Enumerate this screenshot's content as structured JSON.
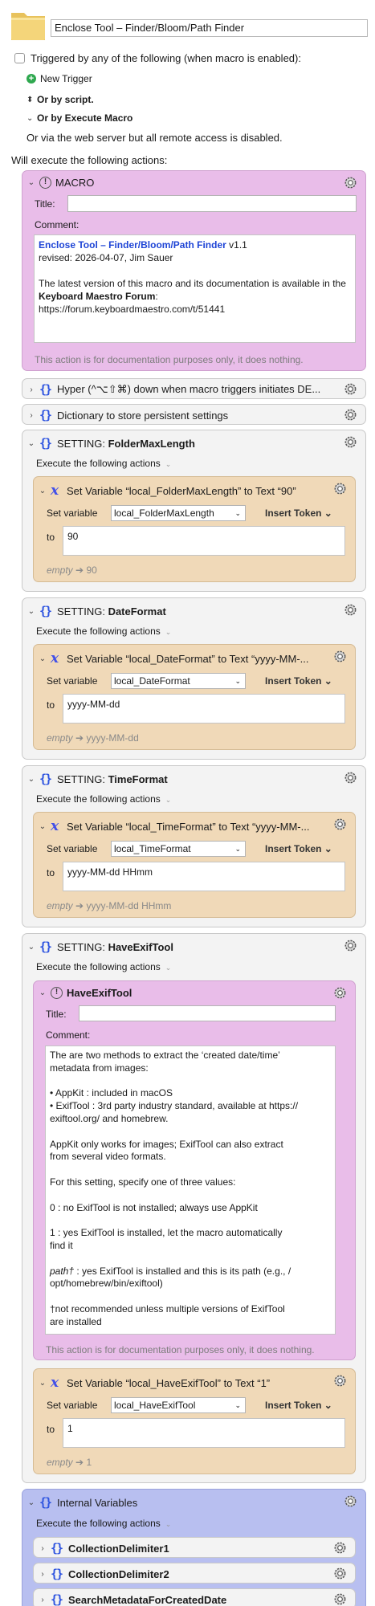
{
  "macro": {
    "name": "Enclose Tool – Finder/Bloom/Path Finder",
    "triggered_by": "Triggered by any of the following (when macro is enabled):",
    "new_trigger": "New Trigger",
    "or_by_script": "Or by script.",
    "or_by_execute": "Or by Execute Macro",
    "web_server_note": "Or via the web server but all remote access is disabled.",
    "will_execute": "Will execute the following actions:"
  },
  "common": {
    "title_label": "Title:",
    "comment_label": "Comment:",
    "doc_caption": "This action is for documentation purposes only, it does nothing.",
    "execute_following": "Execute the following actions",
    "set_variable": "Set variable",
    "to": "to",
    "insert_token": "Insert Token",
    "empty": "empty",
    "arrow": "➔"
  },
  "macro_comment": {
    "title": "MACRO",
    "link": "Enclose Tool – Finder/Bloom/Path Finder",
    "version": " v1.1",
    "revised": "revised: 2026-04-07, Jim Sauer",
    "para1": "The latest version of this macro and its documentation is available in the ",
    "para1_bold": "Keyboard Maestro Forum",
    "para1_end": ":",
    "url": "https://forum.keyboardmaestro.com/t/51441"
  },
  "collapsed": [
    {
      "title": "Hyper (^⌥⇧⌘) down when macro triggers initiates DE..."
    },
    {
      "title": "Dictionary to store persistent settings"
    }
  ],
  "settings": [
    {
      "prefix": "SETTING: ",
      "name": "FolderMaxLength",
      "sv_title": "Set Variable “local_FolderMaxLength” to Text “90”",
      "var": "local_FolderMaxLength",
      "value": "90",
      "result": "90"
    },
    {
      "prefix": "SETTING: ",
      "name": "DateFormat",
      "sv_title": "Set Variable “local_DateFormat” to Text “yyyy-MM-...",
      "var": "local_DateFormat",
      "value": "yyyy-MM-dd",
      "result": "yyyy-MM-dd"
    },
    {
      "prefix": "SETTING: ",
      "name": "TimeFormat",
      "sv_title": "Set Variable “local_TimeFormat” to Text “yyyy-MM-...",
      "var": "local_TimeFormat",
      "value": "yyyy-MM-dd HHmm",
      "result": "yyyy-MM-dd HHmm"
    }
  ],
  "exif": {
    "prefix": "SETTING: ",
    "name": "HaveExifTool",
    "comment_title": "HaveExifTool",
    "lines": [
      "The are two methods to extract the ‘created date/time’",
      "metadata from images:",
      "",
      "• AppKit : included in macOS",
      "• ExifTool : 3rd party industry standard, available at https://",
      "exiftool.org/ and homebrew.",
      "",
      "AppKit only works for images; ExifTool can also extract",
      "from several video formats.",
      "",
      "For this setting, specify one of three values:",
      "",
      "0 : no ExifTool is not installed; always use AppKit",
      "",
      "1 : yes ExifTool is installed, let the macro automatically",
      "find it",
      "",
      "path† : yes ExifTool is installed and this is its path (e.g., /",
      "opt/homebrew/bin/exiftool)",
      "",
      "†not recommended unless multiple versions of ExifTool",
      "are installed"
    ],
    "sv_title": "Set Variable “local_HaveExifTool” to Text “1”",
    "var": "local_HaveExifTool",
    "value": "1",
    "result": "1"
  },
  "internal": {
    "title": "Internal Variables",
    "items": [
      "CollectionDelimiter1",
      "CollectionDelimiter2",
      "SearchMetadataForCreatedDate"
    ]
  }
}
